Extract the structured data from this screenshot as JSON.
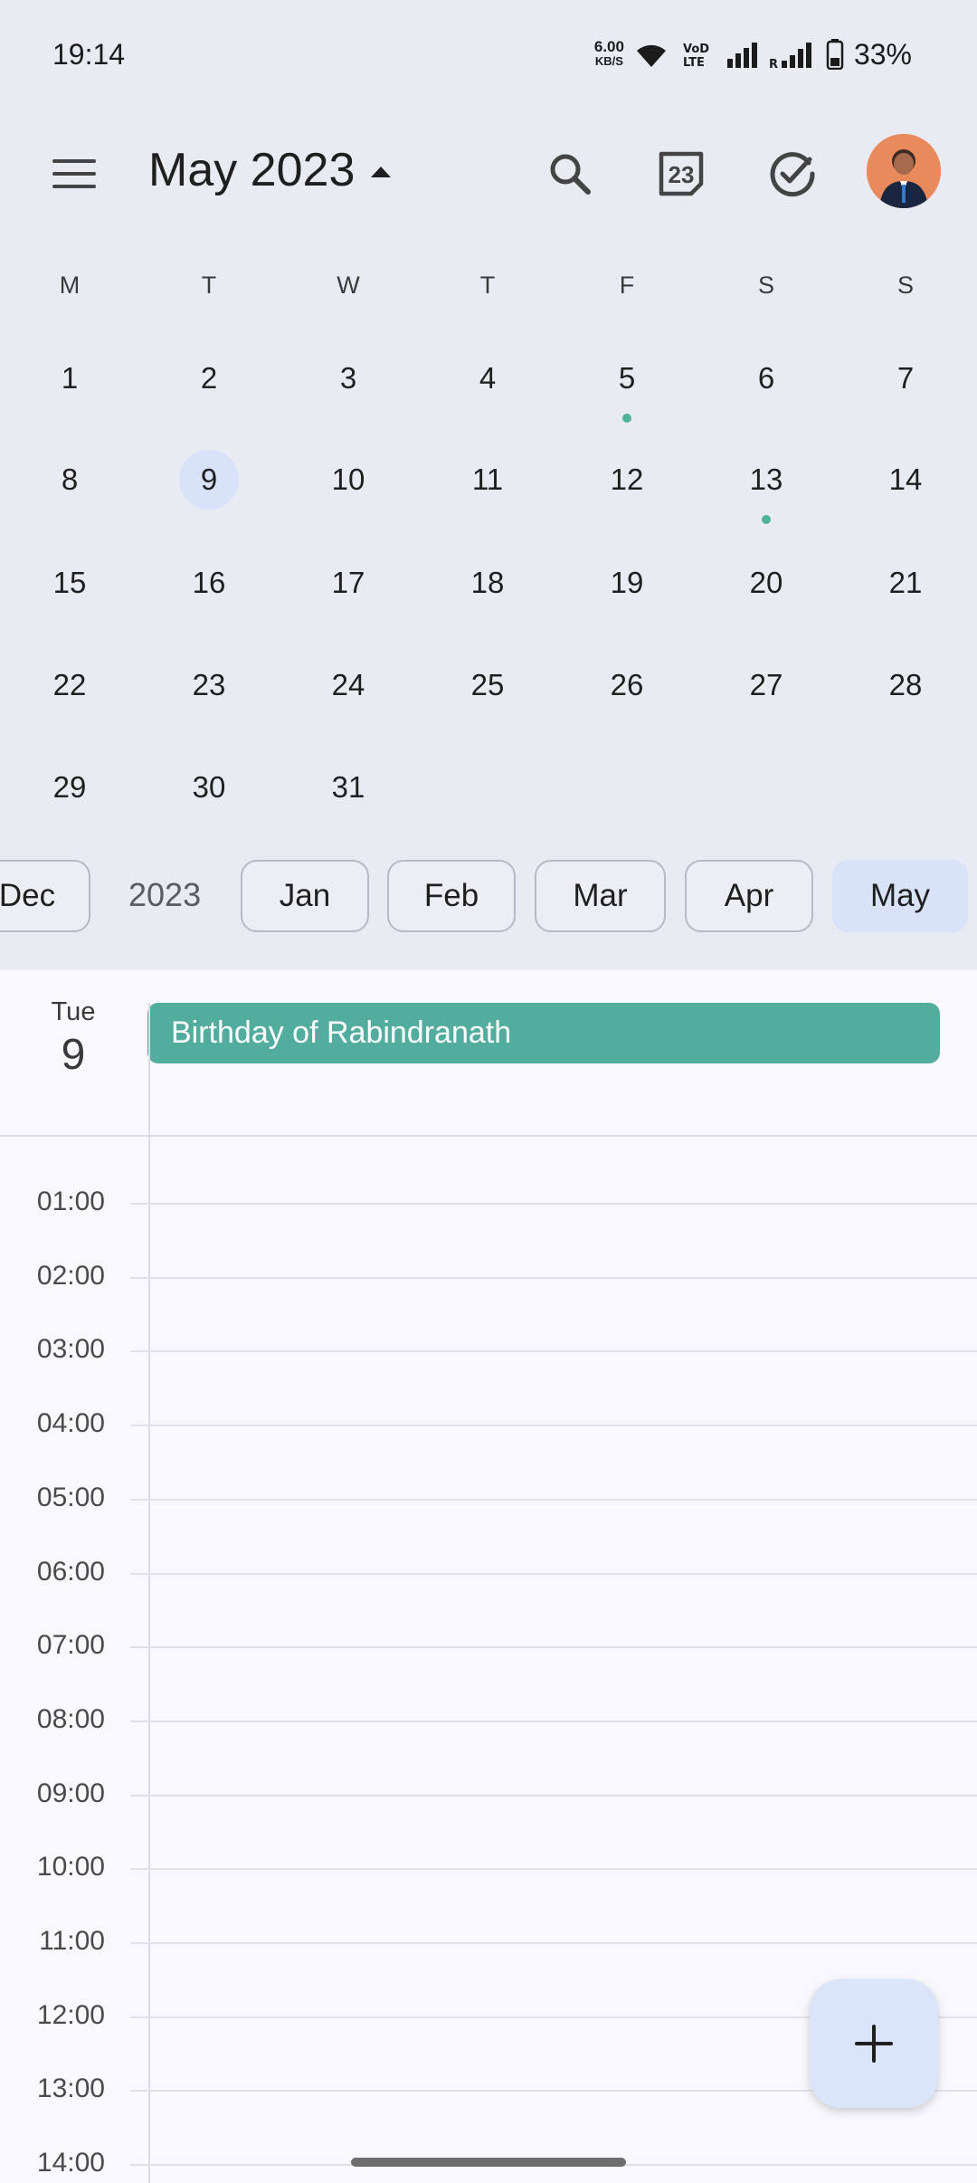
{
  "status_bar": {
    "time": "19:14",
    "net_speed_value": "6.00",
    "net_speed_unit": "KB/S",
    "battery_percent": "33%"
  },
  "app_bar": {
    "month_title": "May 2023",
    "calendar_icon_day": "23",
    "icons": [
      "menu-icon",
      "search-icon",
      "today-calendar-icon",
      "tasks-check-icon"
    ]
  },
  "calendar": {
    "weekdays": [
      "M",
      "T",
      "W",
      "T",
      "F",
      "S",
      "S"
    ],
    "weeks": [
      [
        "1",
        "2",
        "3",
        "4",
        "5",
        "6",
        "7"
      ],
      [
        "8",
        "9",
        "10",
        "11",
        "12",
        "13",
        "14"
      ],
      [
        "15",
        "16",
        "17",
        "18",
        "19",
        "20",
        "21"
      ],
      [
        "22",
        "23",
        "24",
        "25",
        "26",
        "27",
        "28"
      ],
      [
        "29",
        "30",
        "31",
        "",
        "",
        "",
        ""
      ]
    ],
    "selected_day": "9",
    "days_with_events": [
      "5",
      "13"
    ],
    "event_dot_color": "#4fb39a",
    "selected_color": "#d8e2f8"
  },
  "month_chips": {
    "partial_left": "Dec",
    "year": "2023",
    "months": [
      "Jan",
      "Feb",
      "Mar",
      "Apr",
      "May"
    ],
    "active": "May"
  },
  "day_view": {
    "day_of_week": "Tue",
    "day_number": "9",
    "all_day_event": "Birthday of Rabindranath",
    "event_color": "#52ad9f",
    "hours": [
      "01:00",
      "02:00",
      "03:00",
      "04:00",
      "05:00",
      "06:00",
      "07:00",
      "08:00",
      "09:00",
      "10:00",
      "11:00",
      "12:00",
      "13:00",
      "14:00"
    ]
  },
  "fab": {
    "icon": "plus-icon"
  }
}
